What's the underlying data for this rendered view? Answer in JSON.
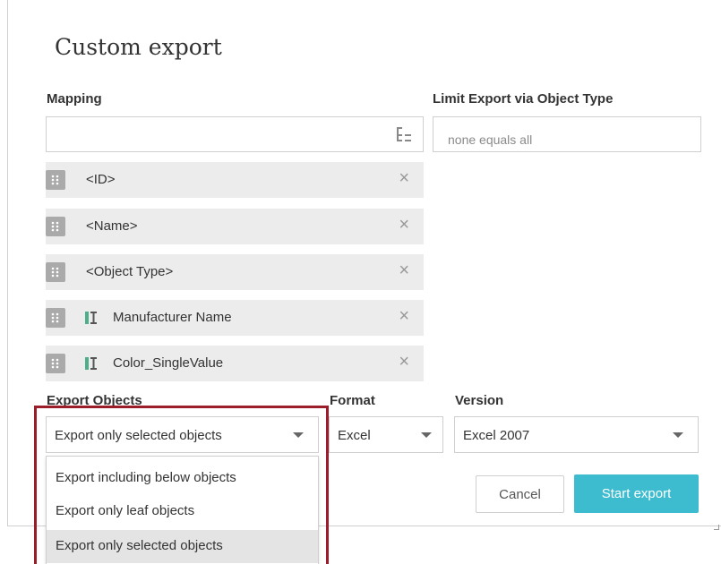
{
  "dialog": {
    "title": "Custom export"
  },
  "mapping": {
    "label": "Mapping",
    "input_value": "",
    "items": [
      {
        "text": "<ID>",
        "has_attr_icon": false
      },
      {
        "text": "<Name>",
        "has_attr_icon": false
      },
      {
        "text": "<Object Type>",
        "has_attr_icon": false
      },
      {
        "text": "Manufacturer Name",
        "has_attr_icon": true
      },
      {
        "text": "Color_SingleValue",
        "has_attr_icon": true
      }
    ],
    "remove_glyph": "×",
    "icons": {
      "tree": "tree-structure-icon",
      "drag": "drag-handle-icon",
      "attribute": "text-attribute-icon"
    }
  },
  "limit": {
    "label": "Limit Export via Object Type",
    "placeholder": "none equals all"
  },
  "export_objects": {
    "label": "Export Objects",
    "selected": "Export only selected objects",
    "options": [
      "Export including below objects",
      "Export only leaf objects",
      "Export only selected objects"
    ]
  },
  "format": {
    "label": "Format",
    "selected": "Excel"
  },
  "version": {
    "label": "Version",
    "selected": "Excel 2007"
  },
  "buttons": {
    "cancel": "Cancel",
    "start": "Start export"
  },
  "colors": {
    "accent": "#3dbcd0",
    "highlight": "#9b1d2a",
    "attr_icon": "#4caf8a"
  }
}
